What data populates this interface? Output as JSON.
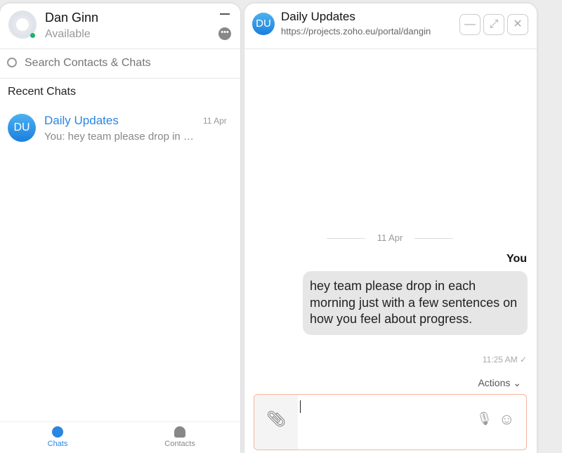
{
  "user": {
    "name": "Dan Ginn",
    "status": "Available",
    "status_color": "#19b36b"
  },
  "search": {
    "placeholder": "Search Contacts & Chats"
  },
  "recent_label": "Recent Chats",
  "chats": [
    {
      "initials": "DU",
      "title": "Daily Updates",
      "date": "11 Apr",
      "preview": "You: hey team please drop in …"
    }
  ],
  "bottom_tabs": [
    {
      "label": "Chats",
      "active": true
    },
    {
      "label": "Contacts",
      "active": false
    }
  ],
  "chat_window": {
    "initials": "DU",
    "title": "Daily Updates",
    "url": "https://projects.zoho.eu/portal/dangin",
    "date_separator": "11 Apr",
    "sender": "You",
    "message": "hey team please drop in each morning just with a few sentences on how you feel about progress.",
    "time": "11:25 AM",
    "tick": "✓",
    "actions_label": "Actions"
  },
  "accent": "#2a86e0"
}
